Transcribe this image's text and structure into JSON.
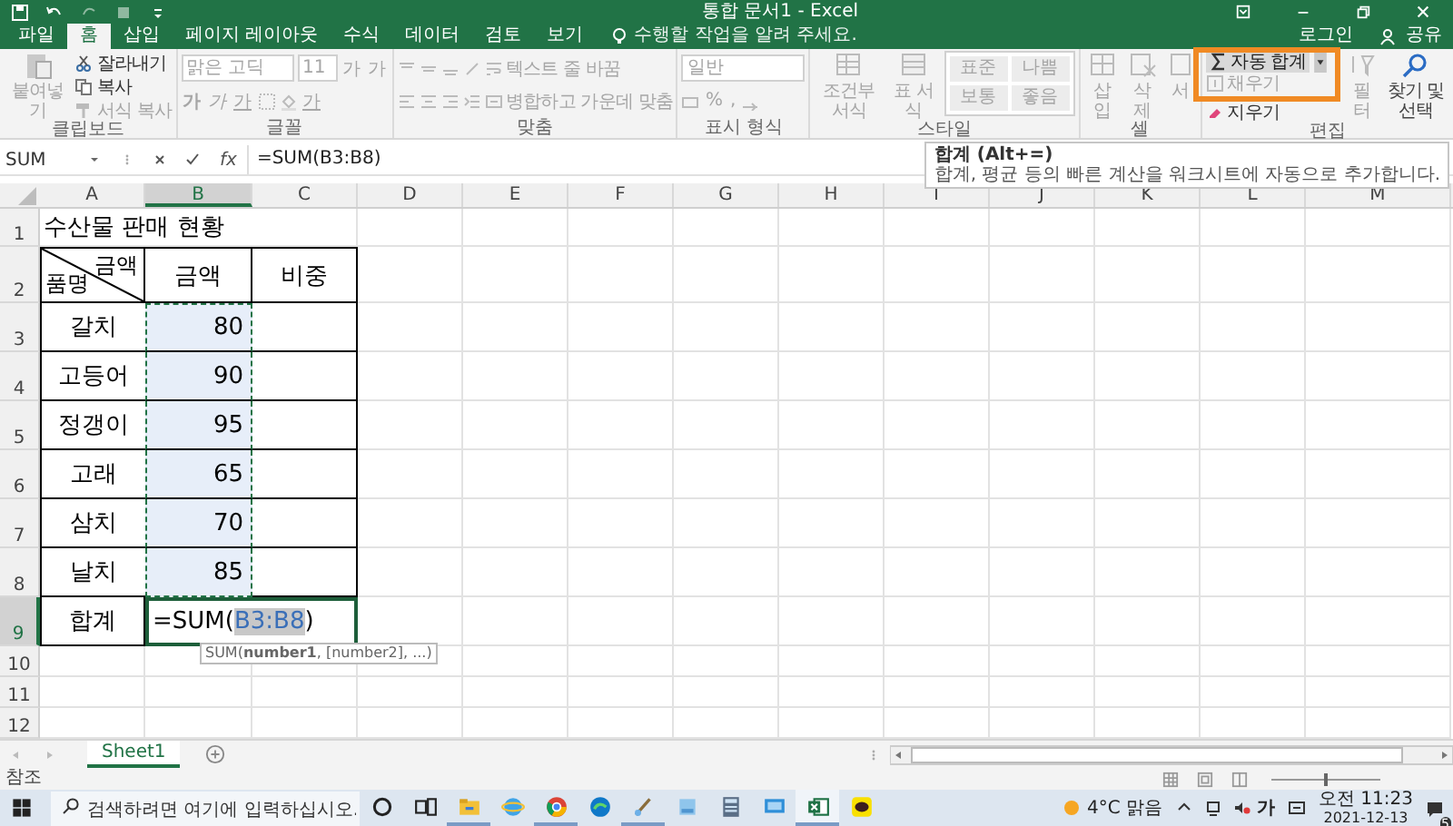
{
  "title_bar": {
    "title": "통합 문서1 - Excel"
  },
  "tabs": [
    {
      "label": "파일",
      "selected": false
    },
    {
      "label": "홈",
      "selected": true
    },
    {
      "label": "삽입",
      "selected": false
    },
    {
      "label": "페이지 레이아웃",
      "selected": false
    },
    {
      "label": "수식",
      "selected": false
    },
    {
      "label": "데이터",
      "selected": false
    },
    {
      "label": "검토",
      "selected": false
    },
    {
      "label": "보기",
      "selected": false
    }
  ],
  "tell_me": "수행할 작업을 알려 주세요.",
  "account": {
    "sign_in": "로그인",
    "share": "공유"
  },
  "ribbon": {
    "clipboard": {
      "label": "클립보드",
      "paste": {
        "text": "붙여넣기",
        "disabled": true
      },
      "cut": {
        "text": "잘라내기",
        "disabled": false
      },
      "copy": {
        "text": "복사",
        "disabled": false
      },
      "format_painter": {
        "text": "서식 복사",
        "disabled": true
      }
    },
    "font": {
      "label": "글꼴",
      "disabled": true,
      "name": "맑은 고딕",
      "size": "11",
      "size_buttons": [
        "가",
        "가"
      ],
      "style_buttons": [
        "가",
        "가",
        "가"
      ],
      "color_button": "가"
    },
    "alignment": {
      "label": "맞춤",
      "disabled": true,
      "wrap": "텍스트 줄 바꿈",
      "merge": "병합하고 가운데 맞춤"
    },
    "number": {
      "label": "표시 형식",
      "disabled": true,
      "format": "일반",
      "buttons": [
        "%",
        ","
      ]
    },
    "styles": {
      "label": "스타일",
      "disabled": true,
      "conditional": "조건부 서식",
      "table": "표 서식",
      "presets": [
        "표준",
        "나쁨",
        "보통",
        "좋음"
      ]
    },
    "cells": {
      "label": "셀",
      "disabled": true,
      "insert": "삽입",
      "delete": "삭제",
      "format": "서"
    },
    "editing": {
      "label": "편집",
      "autosum": {
        "text": "자동 합계",
        "disabled": false
      },
      "fill": {
        "text": "채우기",
        "disabled": true
      },
      "clear": {
        "text": "지우기",
        "disabled": false
      },
      "sort_filter": {
        "text": "필터",
        "disabled": true
      },
      "find": {
        "text": "찾기 및 선택",
        "disabled": false
      }
    },
    "tooltip": {
      "title": "합계 (Alt+=)",
      "body": "합계, 평균 등의 빠른 계산을 워크시트에 자동으로 추가합니다."
    }
  },
  "formula_bar": {
    "name_box": "SUM",
    "function_label": "fx",
    "formula": "=SUM(B3:B8)"
  },
  "columns": [
    {
      "label": "A",
      "selected": false
    },
    {
      "label": "B",
      "selected": true
    },
    {
      "label": "C",
      "selected": false
    },
    {
      "label": "D",
      "selected": false
    },
    {
      "label": "E",
      "selected": false
    },
    {
      "label": "F",
      "selected": false
    },
    {
      "label": "G",
      "selected": false
    },
    {
      "label": "H",
      "selected": false
    },
    {
      "label": "I",
      "selected": false
    },
    {
      "label": "J",
      "selected": false
    },
    {
      "label": "K",
      "selected": false
    },
    {
      "label": "L",
      "selected": false
    },
    {
      "label": "M",
      "selected": false
    }
  ],
  "rows": [
    {
      "header": "1",
      "selected": false,
      "cells": [
        {
          "kind": "title",
          "text": "수산물 판매 현황"
        }
      ]
    },
    {
      "header": "2",
      "selected": false,
      "cells": [
        {
          "kind": "diagonal",
          "top": "금액",
          "bottom": "품명"
        },
        {
          "kind": "header",
          "text": "금액"
        },
        {
          "kind": "header",
          "text": "비중"
        }
      ]
    },
    {
      "header": "3",
      "selected": false,
      "cells": [
        {
          "kind": "label",
          "text": "갈치"
        },
        {
          "kind": "number",
          "text": "80",
          "in_range": true
        },
        {
          "kind": "empty"
        }
      ]
    },
    {
      "header": "4",
      "selected": false,
      "cells": [
        {
          "kind": "label",
          "text": "고등어"
        },
        {
          "kind": "number",
          "text": "90",
          "in_range": true
        },
        {
          "kind": "empty"
        }
      ]
    },
    {
      "header": "5",
      "selected": false,
      "cells": [
        {
          "kind": "label",
          "text": "정갱이"
        },
        {
          "kind": "number",
          "text": "95",
          "in_range": true
        },
        {
          "kind": "empty"
        }
      ]
    },
    {
      "header": "6",
      "selected": false,
      "cells": [
        {
          "kind": "label",
          "text": "고래"
        },
        {
          "kind": "number",
          "text": "65",
          "in_range": true
        },
        {
          "kind": "empty"
        }
      ]
    },
    {
      "header": "7",
      "selected": false,
      "cells": [
        {
          "kind": "label",
          "text": "삼치"
        },
        {
          "kind": "number",
          "text": "70",
          "in_range": true
        },
        {
          "kind": "empty"
        }
      ]
    },
    {
      "header": "8",
      "selected": false,
      "cells": [
        {
          "kind": "label",
          "text": "날치"
        },
        {
          "kind": "number",
          "text": "85",
          "in_range": true
        },
        {
          "kind": "empty"
        }
      ]
    },
    {
      "header": "9",
      "selected": true,
      "cells": [
        {
          "kind": "label",
          "text": "합계"
        },
        {
          "kind": "editing",
          "before": "=SUM(",
          "ref": "B3:B8",
          "after": ")",
          "in_range": false
        },
        {
          "kind": "empty"
        }
      ]
    },
    {
      "header": "10",
      "selected": false,
      "cells": []
    },
    {
      "header": "11",
      "selected": false,
      "cells": []
    },
    {
      "header": "12",
      "selected": false,
      "cells": []
    }
  ],
  "function_hint": "SUM(**number1**, [number2], ...)",
  "sheets": [
    {
      "label": "Sheet1",
      "selected": true
    }
  ],
  "status_bar": {
    "mode": "참조",
    "zoom": {
      "level": 0.5
    }
  },
  "taskbar": {
    "search_placeholder": "검색하려면 여기에 입력하십시오.",
    "apps": [
      {
        "kind": "circle",
        "running": false,
        "selected": false
      },
      {
        "kind": "taskview",
        "running": false,
        "selected": false
      },
      {
        "kind": "folder",
        "running": true,
        "selected": false
      },
      {
        "kind": "globe",
        "running": false,
        "selected": false
      },
      {
        "kind": "tricolor",
        "running": true,
        "selected": false
      },
      {
        "kind": "swirl",
        "running": false,
        "selected": false
      },
      {
        "kind": "brush",
        "running": true,
        "selected": false
      },
      {
        "kind": "tablet",
        "running": false,
        "selected": false
      },
      {
        "kind": "calculator",
        "running": false,
        "selected": false
      },
      {
        "kind": "monitor",
        "running": false,
        "selected": false
      },
      {
        "kind": "sheet",
        "running": true,
        "selected": true
      },
      {
        "kind": "chat",
        "running": false,
        "selected": false
      }
    ],
    "weather": "4°C 맑음",
    "ime": "가",
    "time": "오전 11:23",
    "date": "2021-12-13",
    "notifications": "5"
  }
}
